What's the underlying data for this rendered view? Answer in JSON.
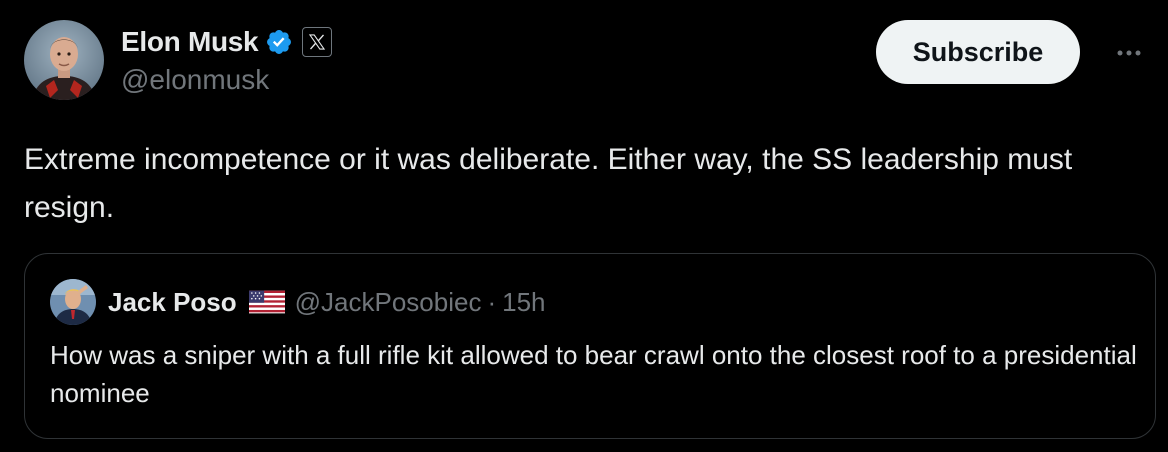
{
  "author": {
    "display_name": "Elon Musk",
    "handle": "@elonmusk",
    "verified": true,
    "affiliate_badge_icon": "x-logo-icon"
  },
  "actions": {
    "subscribe_label": "Subscribe",
    "more_icon": "more-icon"
  },
  "tweet": {
    "text": "Extreme incompetence or it was deliberate. Either way, the SS leadership must resign."
  },
  "quote": {
    "display_name": "Jack Poso",
    "flag_icon": "us-flag-icon",
    "handle": "@JackPosobiec",
    "separator": "·",
    "time": "15h",
    "text": "How was a sniper with a full rifle kit allowed to bear crawl onto the closest roof to a presidential nominee"
  },
  "colors": {
    "background": "#000000",
    "primary_text": "#e7e9ea",
    "secondary_text": "#71767b",
    "verified_blue": "#1d9bf0",
    "border": "#2f3336",
    "button_bg": "#eff3f4"
  }
}
